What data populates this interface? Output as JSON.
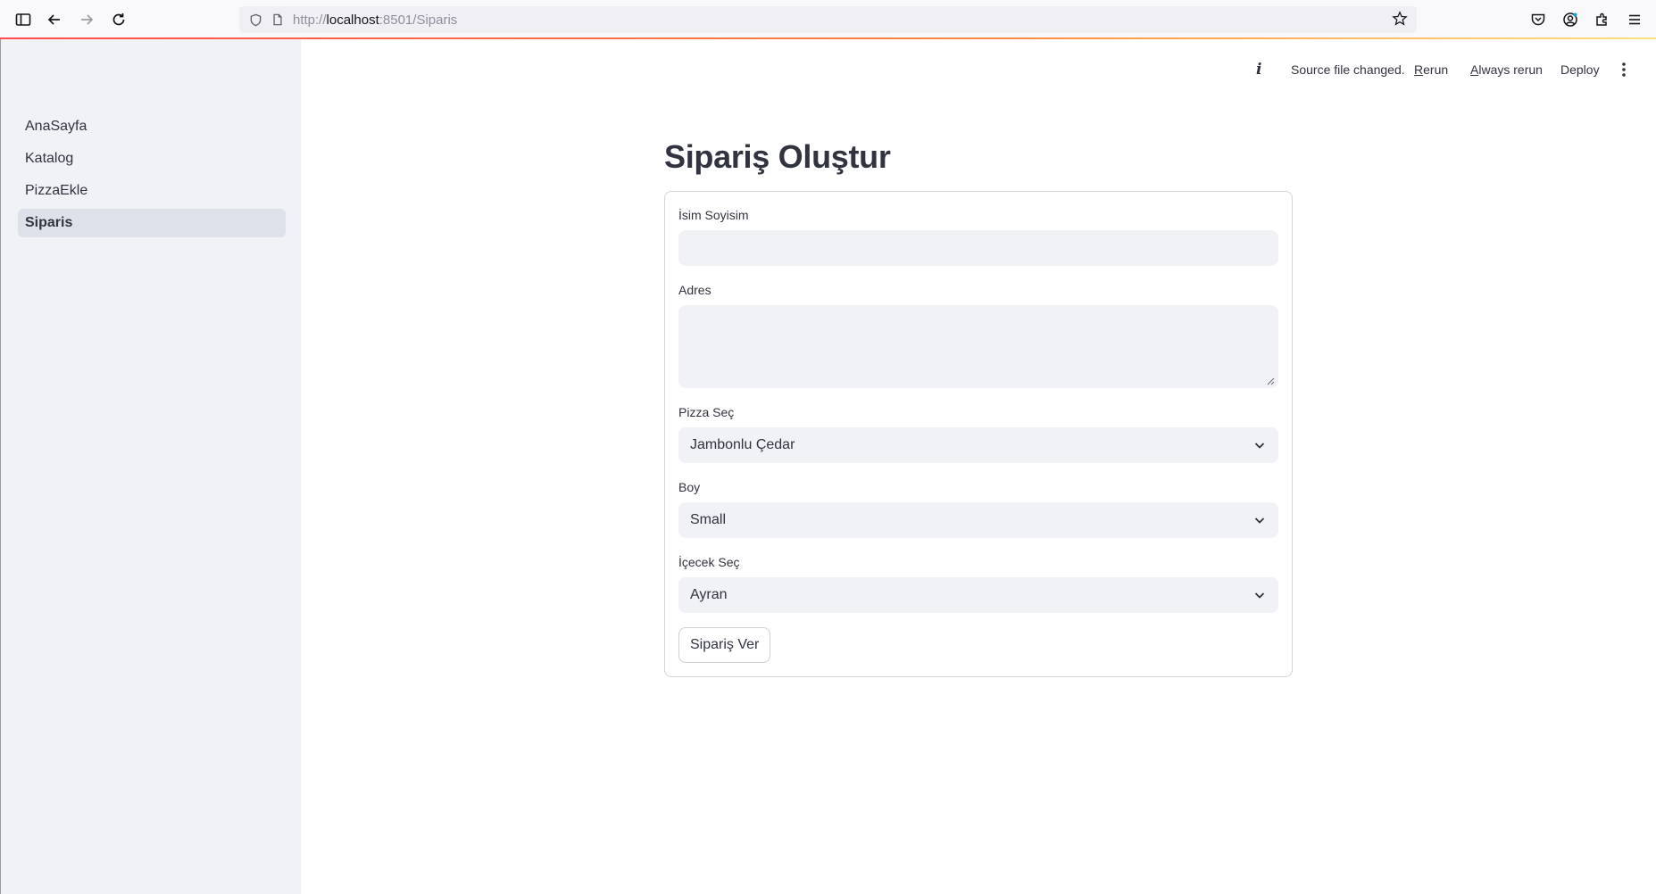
{
  "browser": {
    "url_prefix": "http://",
    "url_host": "localhost",
    "url_rest": ":8501/Siparis"
  },
  "sidebar": {
    "items": [
      {
        "label": "AnaSayfa",
        "active": false
      },
      {
        "label": "Katalog",
        "active": false
      },
      {
        "label": "PizzaEkle",
        "active": false
      },
      {
        "label": "Siparis",
        "active": true
      }
    ]
  },
  "header": {
    "status_text": "Source file changed.",
    "rerun_first": "R",
    "rerun_rest": "erun",
    "always_first": "A",
    "always_rest": "lways rerun",
    "deploy_label": "Deploy"
  },
  "page": {
    "title": "Sipariş Oluştur"
  },
  "form": {
    "name_label": "İsim Soyisim",
    "name_value": "",
    "address_label": "Adres",
    "address_value": "",
    "pizza_label": "Pizza Seç",
    "pizza_value": "Jambonlu Çedar",
    "size_label": "Boy",
    "size_value": "Small",
    "drink_label": "İçecek Seç",
    "drink_value": "Ayran",
    "submit_label": "Sipariş Ver"
  },
  "colors": {
    "sidebar_bg": "#f0f2f6",
    "input_bg": "#f0f2f6",
    "text": "#31333f",
    "active_item_bg": "#dde1e9"
  }
}
